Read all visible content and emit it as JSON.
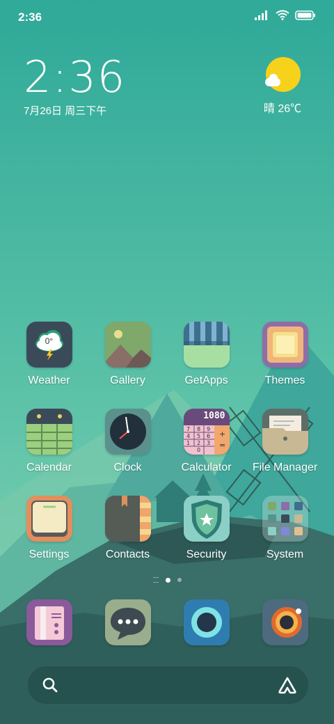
{
  "status_bar": {
    "time": "2:36",
    "icons": [
      "signal-icon",
      "wifi-icon",
      "battery-icon"
    ]
  },
  "clock_widget": {
    "time": "2:36",
    "date": "7月26日 周三下午"
  },
  "weather_widget": {
    "icon": "sun-cloud-icon",
    "text": "晴 26℃"
  },
  "apps": [
    {
      "label": "Weather",
      "icon": "weather-icon",
      "badge": "0°"
    },
    {
      "label": "Gallery",
      "icon": "gallery-icon"
    },
    {
      "label": "GetApps",
      "icon": "getapps-icon"
    },
    {
      "label": "Themes",
      "icon": "themes-icon"
    },
    {
      "label": "Calendar",
      "icon": "calendar-icon"
    },
    {
      "label": "Clock",
      "icon": "clock-icon"
    },
    {
      "label": "Calculator",
      "icon": "calculator-icon",
      "display": "1080"
    },
    {
      "label": "File Manager",
      "icon": "file-manager-icon"
    },
    {
      "label": "Settings",
      "icon": "settings-icon"
    },
    {
      "label": "Contacts",
      "icon": "contacts-icon"
    },
    {
      "label": "Security",
      "icon": "security-icon"
    },
    {
      "label": "System",
      "icon": "system-folder-icon"
    }
  ],
  "dock": [
    {
      "icon": "phone-icon"
    },
    {
      "icon": "messages-icon"
    },
    {
      "icon": "browser-icon"
    },
    {
      "icon": "camera-icon"
    }
  ],
  "page_indicator": {
    "pages": 2,
    "current": 1
  },
  "search_bar": {
    "left_icon": "search-icon",
    "right_icon": "assistant-icon"
  },
  "colors": {
    "sky_top": "#2fa999",
    "sky_bottom": "#7bcfb0",
    "mountain": "#3a9c93",
    "sun": "#f7d21a"
  }
}
